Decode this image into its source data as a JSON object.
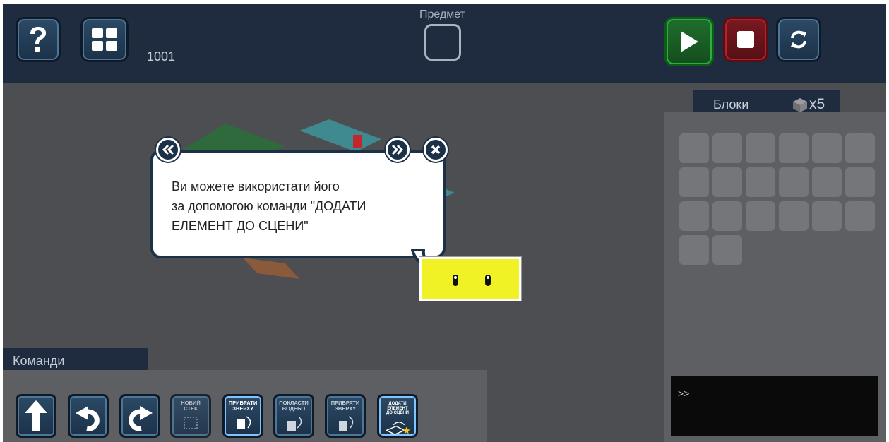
{
  "header": {
    "help_icon": "question-mark-icon",
    "menu_icon": "grid-icon",
    "level_number": "1001",
    "item_label": "Предмет",
    "play_icon": "play-icon",
    "stop_icon": "stop-icon",
    "reset_icon": "refresh-icon"
  },
  "colors": {
    "topbar": "#1f2c40",
    "scene_bg": "#4c4e51",
    "play_accent": "#22a834",
    "stop_accent": "#b01e2a",
    "highlight": "#f0f225"
  },
  "blocks_panel": {
    "title": "Блоки",
    "count": "x5",
    "slot_count": 20
  },
  "tooltip": {
    "line1": "Ви можете використати його",
    "line2": "за допомогою команди \"ДОДАТИ",
    "line3": "ЕЛЕМЕНТ ДО СЦЕНИ\""
  },
  "console": {
    "prompt": ">>"
  },
  "commands": {
    "title": "Команди",
    "buttons": [
      {
        "icon": "arrow-up-icon"
      },
      {
        "icon": "rotate-left-icon"
      },
      {
        "icon": "rotate-right-icon"
      },
      {
        "line1": "НОВИЙ",
        "line2": "СТЕК"
      },
      {
        "line1": "ПРИБРАТИ",
        "line2": "ЗВЕРХУ"
      },
      {
        "line1": "ПОКЛАСТИ",
        "line2": "ВОДЕБО"
      },
      {
        "line1": "ПРИБРАТИ",
        "line2": "ЗВЕРХУ"
      },
      {
        "line1": "ДОДАТИ ЕЛЕМЕНТ",
        "line2": "ДО СЦЕНИ"
      }
    ]
  }
}
